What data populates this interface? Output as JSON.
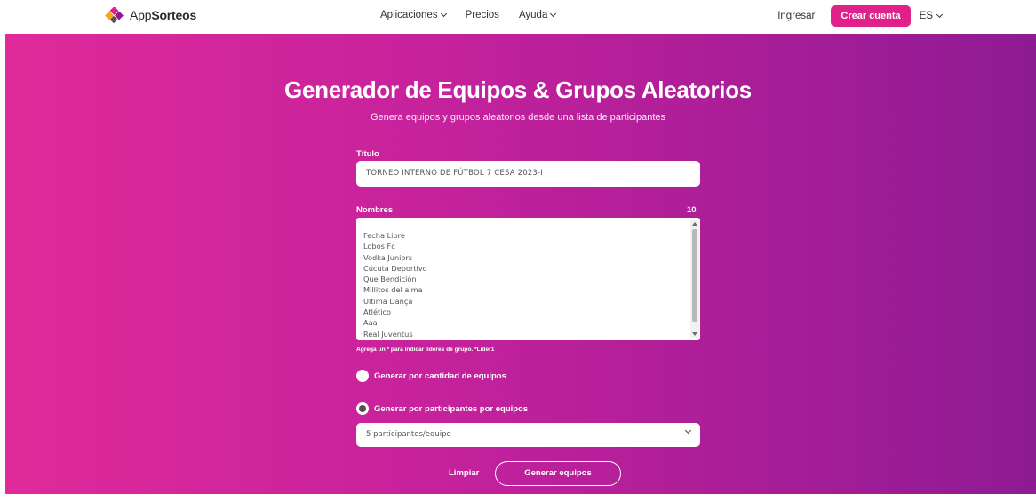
{
  "brand": {
    "prefix": "App",
    "name": "Sorteos"
  },
  "nav": {
    "items": [
      {
        "label": "Aplicaciones",
        "has_dropdown": true
      },
      {
        "label": "Precios",
        "has_dropdown": false
      },
      {
        "label": "Ayuda",
        "has_dropdown": true
      }
    ],
    "login": "Ingresar",
    "signup": "Crear cuenta",
    "language": "ES"
  },
  "hero": {
    "title": "Generador de Equipos & Grupos Aleatorios",
    "subtitle": "Genera equipos y grupos aleatorios desde una lista de participantes"
  },
  "form": {
    "title_label": "Título",
    "title_value": "TORNEO INTERNO DE FÚTBOL 7 CESA 2023-I",
    "names_label": "Nombres",
    "names_count": "10",
    "names": [
      "Fecha Libre",
      "Lobos Fc",
      "Vodka Juniors",
      "Cúcuta Deportivo",
      "Que Bendición",
      "Millitos del alma",
      "Ultima Dança",
      "Atlético",
      "Aaa",
      "Real Juventus"
    ],
    "hint": "Agrega un * para indicar líderes de grupo. *Lider1",
    "radio_by_teams": "Generar por cantidad de equipos",
    "radio_by_participants": "Generar por participantes por equipos",
    "selected_mode": "participants",
    "select_value": "5 participantes/equipo",
    "clear_label": "Limpiar",
    "generate_label": "Generar equipos"
  },
  "colors": {
    "accent": "#e0218a",
    "gradient_start": "#e02a9a",
    "gradient_end": "#8e1b93"
  }
}
